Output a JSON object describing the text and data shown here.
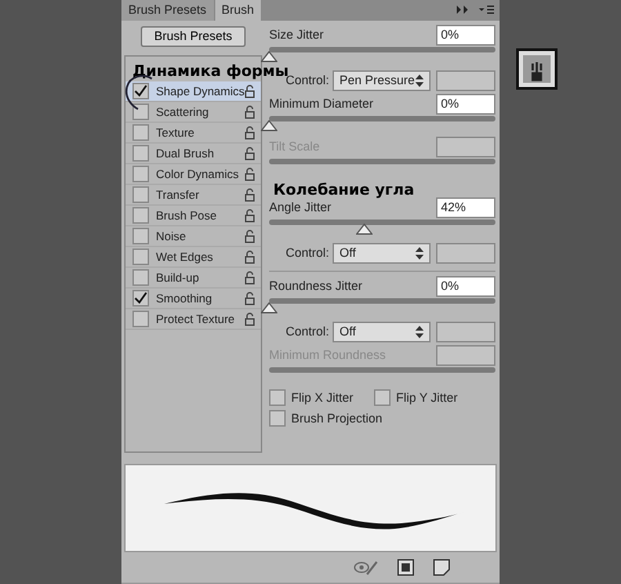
{
  "tabs": [
    {
      "label": "Brush Presets",
      "selected": false
    },
    {
      "label": "Brush",
      "selected": true
    }
  ],
  "presets_button": "Brush Presets",
  "options": [
    {
      "label": "Shape Dynamics",
      "checked": true,
      "selected": true
    },
    {
      "label": "Scattering",
      "checked": false,
      "selected": false
    },
    {
      "label": "Texture",
      "checked": false,
      "selected": false
    },
    {
      "label": "Dual Brush",
      "checked": false,
      "selected": false
    },
    {
      "label": "Color Dynamics",
      "checked": false,
      "selected": false
    },
    {
      "label": "Transfer",
      "checked": false,
      "selected": false
    },
    {
      "label": "Brush Pose",
      "checked": false,
      "selected": false
    },
    {
      "label": "Noise",
      "checked": false,
      "selected": false
    },
    {
      "label": "Wet Edges",
      "checked": false,
      "selected": false
    },
    {
      "label": "Build-up",
      "checked": false,
      "selected": false
    },
    {
      "label": "Smoothing",
      "checked": true,
      "selected": false
    },
    {
      "label": "Protect Texture",
      "checked": false,
      "selected": false
    }
  ],
  "annotations": [
    "Динамика формы",
    "Колебание угла"
  ],
  "settings": [
    {
      "kind": "slider",
      "label": "Size Jitter",
      "value": "0%",
      "level": 0,
      "disabled": false
    },
    {
      "kind": "control",
      "label": "Control:",
      "value": "Pen Pressure"
    },
    {
      "kind": "slider",
      "label": "Minimum Diameter",
      "value": "0%",
      "level": 0,
      "disabled": false
    },
    {
      "kind": "slider",
      "label": "Tilt Scale",
      "disabled": true
    },
    {
      "kind": "note"
    },
    {
      "kind": "slider",
      "label": "Angle Jitter",
      "value": "42%",
      "level": 0.42,
      "disabled": false
    },
    {
      "kind": "control",
      "label": "Control:",
      "value": "Off"
    },
    {
      "kind": "divider"
    },
    {
      "kind": "slider",
      "label": "Roundness Jitter",
      "value": "0%",
      "level": 0,
      "disabled": false
    },
    {
      "kind": "control",
      "label": "Control:",
      "value": "Off"
    },
    {
      "kind": "slider",
      "label": "Minimum Roundness",
      "disabled": true
    }
  ],
  "flips": [
    {
      "label": "Flip X Jitter",
      "checked": false
    },
    {
      "label": "Flip Y Jitter",
      "checked": false
    },
    {
      "label": "Brush Projection",
      "checked": false
    }
  ]
}
